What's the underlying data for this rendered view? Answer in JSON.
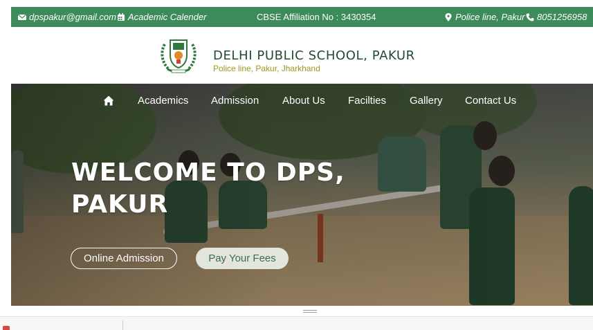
{
  "topbar": {
    "email": "dpspakur@gmail.com",
    "calendar": "Academic Calender",
    "affiliation": "CBSE Affiliation No : 3430354",
    "location": "Police line, Pakur",
    "phone": "8051256958",
    "bg_color": "#3d8b5b",
    "icons": [
      "envelope-icon",
      "calendar-icon",
      "map-marker-icon",
      "phone-icon"
    ]
  },
  "header": {
    "school_name": "DELHI PUBLIC SCHOOL, PAKUR",
    "address": "Police line, Pakur, Jharkhand",
    "name_color": "#1f4c2e",
    "address_color": "#9a9a1f"
  },
  "nav": {
    "home_icon": "home-icon",
    "items": [
      {
        "label": "Academics"
      },
      {
        "label": "Admission"
      },
      {
        "label": "About Us"
      },
      {
        "label": "Facilties"
      },
      {
        "label": "Gallery"
      },
      {
        "label": "Contact Us"
      }
    ]
  },
  "hero": {
    "title_line1": "WELCOME TO DPS,",
    "title_line2": "PAKUR",
    "online_admission": "Online Admission",
    "pay_fees": "Pay Your Fees"
  }
}
